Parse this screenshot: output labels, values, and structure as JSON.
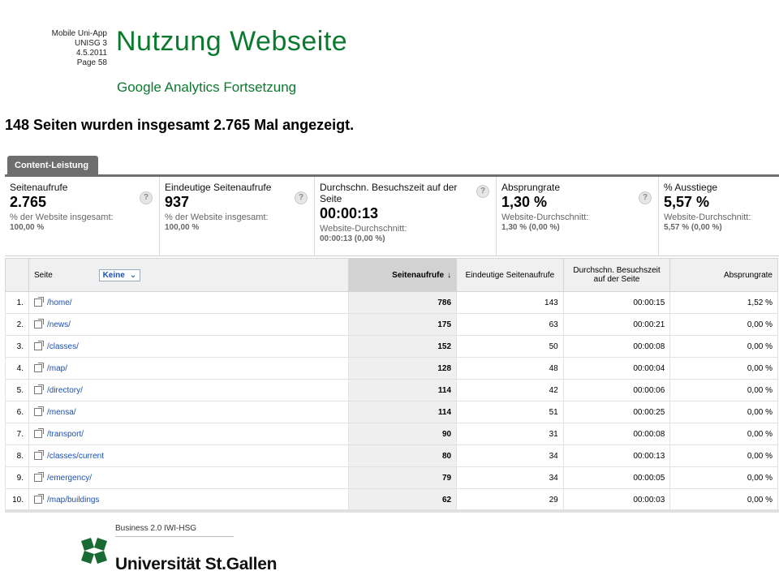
{
  "slide": {
    "meta": [
      "Mobile Uni-App",
      "UNISG 3",
      "4.5.2011",
      "Page 58"
    ],
    "title": "Nutzung Webseite",
    "subtitle": "Google Analytics Fortsetzung",
    "summary": "148 Seiten wurden insgesamt 2.765 Mal angezeigt."
  },
  "tab": {
    "label": "Content-Leistung"
  },
  "metrics": [
    {
      "label": "Seitenaufrufe",
      "value": "2.765",
      "sub1": "% der Website insgesamt:",
      "sub2": "100,00 %"
    },
    {
      "label": "Eindeutige Seitenaufrufe",
      "value": "937",
      "sub1": "% der Website insgesamt:",
      "sub2": "100,00 %"
    },
    {
      "label": "Durchschn. Besuchszeit auf der Seite",
      "value": "00:00:13",
      "sub1": "Website-Durchschnitt:",
      "sub2": "00:00:13 (0,00 %)"
    },
    {
      "label": "Absprungrate",
      "value": "1,30 %",
      "sub1": "Website-Durchschnitt:",
      "sub2": "1,30 % (0,00 %)"
    },
    {
      "label": "% Ausstiege",
      "value": "5,57 %",
      "sub1": "Website-Durchschnitt:",
      "sub2": "5,57 % (0,00 %)"
    }
  ],
  "help_glyph": "?",
  "table": {
    "headers": {
      "page": "Seite",
      "segment": "Keine",
      "segment_arrow": "⌄",
      "pageviews": "Seitenaufrufe",
      "sort_arrow": "↓",
      "unique": "Eindeutige Seitenaufrufe",
      "time": "Durchschn. Besuchszeit auf der Seite",
      "bounce": "Absprungrate"
    },
    "rows": [
      {
        "n": "1.",
        "page": "/home/",
        "pv": "786",
        "up": "143",
        "time": "00:00:15",
        "bounce": "1,52 %"
      },
      {
        "n": "2.",
        "page": "/news/",
        "pv": "175",
        "up": "63",
        "time": "00:00:21",
        "bounce": "0,00 %"
      },
      {
        "n": "3.",
        "page": "/classes/",
        "pv": "152",
        "up": "50",
        "time": "00:00:08",
        "bounce": "0,00 %"
      },
      {
        "n": "4.",
        "page": "/map/",
        "pv": "128",
        "up": "48",
        "time": "00:00:04",
        "bounce": "0,00 %"
      },
      {
        "n": "5.",
        "page": "/directory/",
        "pv": "114",
        "up": "42",
        "time": "00:00:06",
        "bounce": "0,00 %"
      },
      {
        "n": "6.",
        "page": "/mensa/",
        "pv": "114",
        "up": "51",
        "time": "00:00:25",
        "bounce": "0,00 %"
      },
      {
        "n": "7.",
        "page": "/transport/",
        "pv": "90",
        "up": "31",
        "time": "00:00:08",
        "bounce": "0,00 %"
      },
      {
        "n": "8.",
        "page": "/classes/current",
        "pv": "80",
        "up": "34",
        "time": "00:00:13",
        "bounce": "0,00 %"
      },
      {
        "n": "9.",
        "page": "/emergency/",
        "pv": "79",
        "up": "34",
        "time": "00:00:05",
        "bounce": "0,00 %"
      },
      {
        "n": "10.",
        "page": "/map/buildings",
        "pv": "62",
        "up": "29",
        "time": "00:00:03",
        "bounce": "0,00 %"
      }
    ]
  },
  "footer": {
    "logo_tagline": "Business 2.0 IWI-HSG",
    "logo_name": "Universität St.Gallen"
  },
  "colors": {
    "title": "#0b7a2e",
    "link": "#1b4fb3",
    "logo": "#1a6b33"
  }
}
